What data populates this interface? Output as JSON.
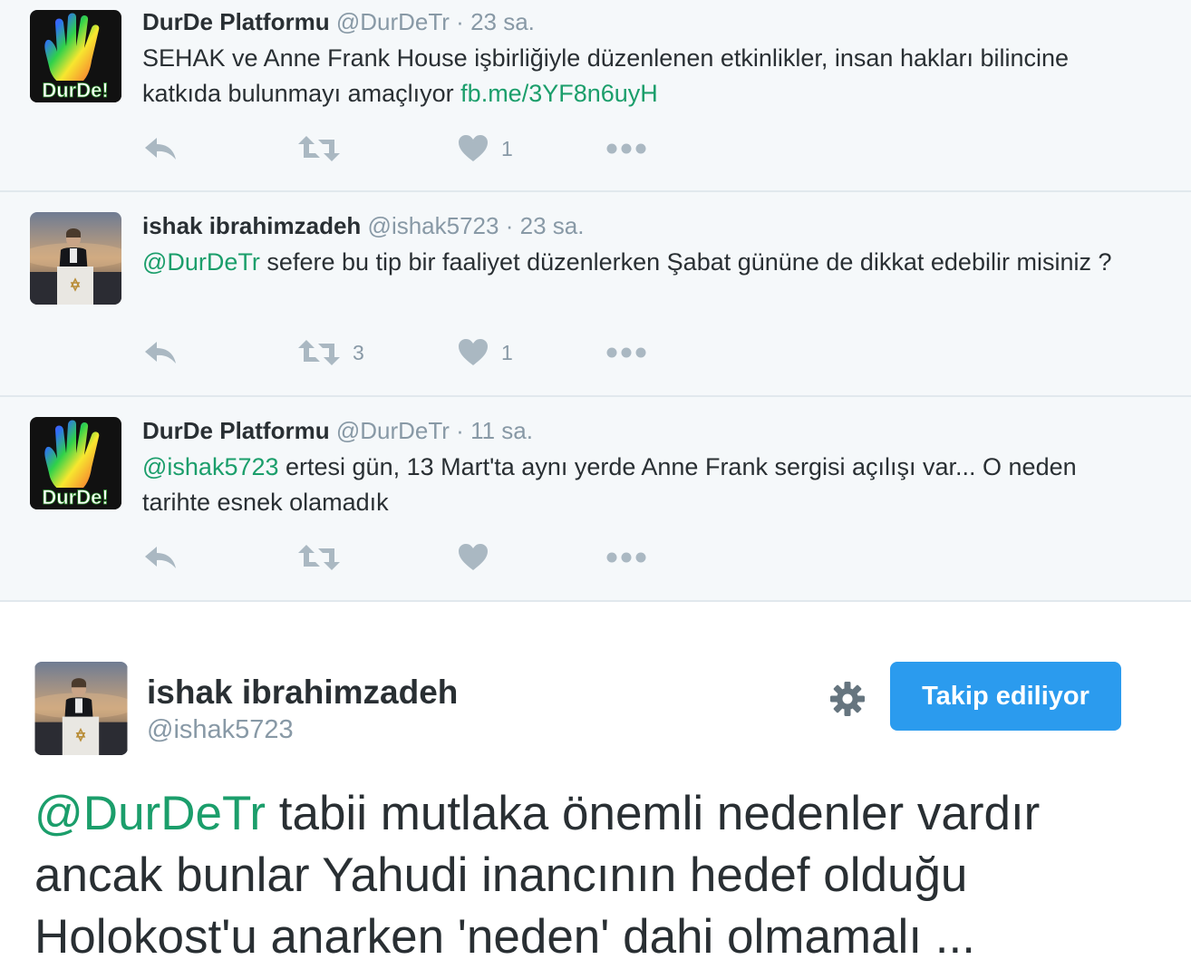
{
  "tweets": [
    {
      "name": "DurDe Platformu",
      "handle": "@DurDeTr",
      "separator": "·",
      "time": "23 sa.",
      "avatar": "durde-logo",
      "avatar_label": "DurDe!",
      "mention": "",
      "text": "SEHAK ve Anne Frank House işbirliğiyle düzenlenen etkinlikler, insan hakları bilincine katkıda bulunmayı amaçlıyor ",
      "link": "fb.me/3YF8n6uyH",
      "retweet_count": "",
      "like_count": "1"
    },
    {
      "name": "ishak ibrahimzadeh",
      "handle": "@ishak5723",
      "separator": "·",
      "time": "23 sa.",
      "avatar": "person-photo",
      "mention": "@DurDeTr",
      "text": " sefere bu tip bir faaliyet düzenlerken Şabat gününe de dikkat edebilir misiniz ?",
      "link": "",
      "retweet_count": "3",
      "like_count": "1"
    },
    {
      "name": "DurDe Platformu",
      "handle": "@DurDeTr",
      "separator": "·",
      "time": "11 sa.",
      "avatar": "durde-logo",
      "avatar_label": "DurDe!",
      "mention": "@ishak5723",
      "text": " ertesi gün, 13 Mart'ta aynı yerde Anne Frank sergisi açılışı var... O neden tarihte esnek olamadık",
      "link": "",
      "retweet_count": "",
      "like_count": ""
    }
  ],
  "detail": {
    "name": "ishak ibrahimzadeh",
    "handle": "@ishak5723",
    "follow_label": "Takip ediliyor",
    "mention": "@DurDeTr",
    "text": " tabii mutlaka önemli nedenler vardır ancak bunlar Yahudi inancının hedef olduğu Holokost'u anarken 'neden' dahi olmamalı ..."
  },
  "icons": {
    "reply": "reply-icon",
    "retweet": "retweet-icon",
    "like": "heart-icon",
    "more": "more-icon",
    "settings": "gear-icon"
  },
  "colors": {
    "link": "#1b9e6b",
    "follow_button": "#2b9bee",
    "action_icon": "#aab8c2",
    "muted_text": "#8899a6",
    "tweet_background": "#f5f8fa"
  }
}
